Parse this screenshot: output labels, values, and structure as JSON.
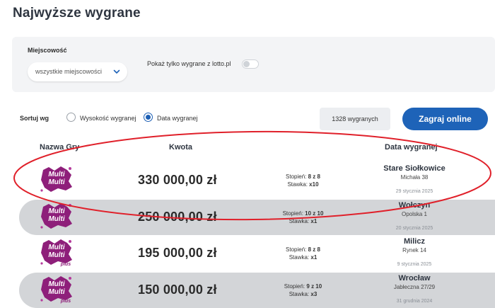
{
  "page": {
    "title": "Najwyższe wygrane"
  },
  "filters": {
    "city_label": "Miejscowość",
    "city_selected": "wszystkie miejscowości",
    "lotto_only_label": "Pokaż tylko wygrane z lotto.pl",
    "lotto_only_enabled": false
  },
  "sort": {
    "label": "Sortuj wg",
    "options": [
      {
        "label": "Wysokość wygranej",
        "selected": false
      },
      {
        "label": "Data wygranej",
        "selected": true
      }
    ]
  },
  "results_count": "1328 wygranych",
  "play_button_label": "Zagraj online",
  "columns": {
    "game": "Nazwa Gry",
    "amount": "Kwota",
    "date": "Data wygranej"
  },
  "colors": {
    "accent": "#1e63b8",
    "logo_purple": "#8e1f7a",
    "highlight": "#e0202a",
    "row_shade": "#d3d5d8"
  },
  "rows": [
    {
      "logo": "multi-multi-logo",
      "logo_text": [
        "Multi",
        "Multi"
      ],
      "plus": "",
      "amount": "330 000,00 zł",
      "stopien_label": "Stopień:",
      "stopien": "8 z 8",
      "stawka_label": "Stawka:",
      "stawka": "x10",
      "city": "Stare Siołkowice",
      "street": "Michała 38",
      "date": "29 stycznia 2025"
    },
    {
      "logo": "multi-multi-logo",
      "logo_text": [
        "Multi",
        "Multi"
      ],
      "plus": "",
      "amount": "250 000,00 zł",
      "stopien_label": "Stopień:",
      "stopien": "10 z 10",
      "stawka_label": "Stawka:",
      "stawka": "x1",
      "city": "Wołczyn",
      "street": "Opolska 1",
      "date": "20 stycznia 2025"
    },
    {
      "logo": "multi-multi-plus-logo",
      "logo_text": [
        "Multi",
        "Multi"
      ],
      "plus": "plus",
      "amount": "195 000,00 zł",
      "stopien_label": "Stopień:",
      "stopien": "8 z 8",
      "stawka_label": "Stawka:",
      "stawka": "x1",
      "city": "Milicz",
      "street": "Rynek 14",
      "date": "9 stycznia 2025"
    },
    {
      "logo": "multi-multi-plus-logo",
      "logo_text": [
        "Multi",
        "Multi"
      ],
      "plus": "plus",
      "amount": "150 000,00 zł",
      "stopien_label": "Stopień:",
      "stopien": "9 z 10",
      "stawka_label": "Stawka:",
      "stawka": "x3",
      "city": "Wrocław",
      "street": "Jabłeczna 27/29",
      "date": "31 grudnia 2024"
    }
  ]
}
